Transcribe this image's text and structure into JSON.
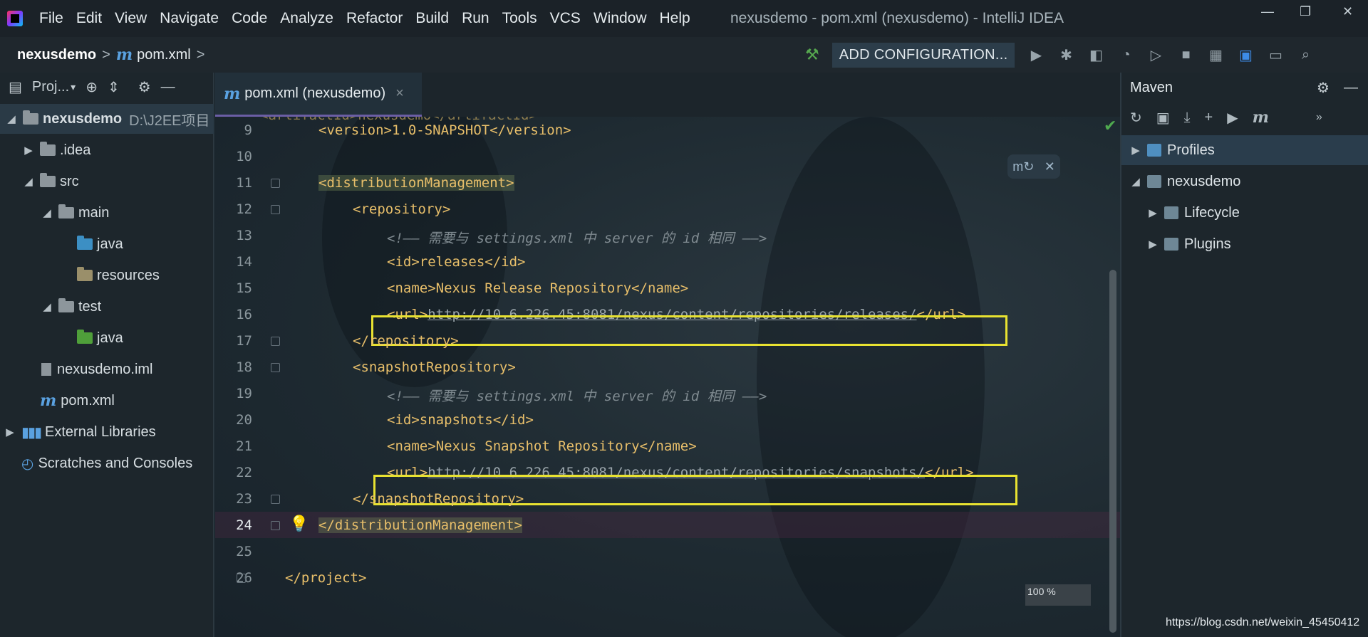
{
  "app": {
    "window_title": "nexusdemo - pom.xml (nexusdemo) - IntelliJ IDEA"
  },
  "menu": [
    "File",
    "Edit",
    "View",
    "Navigate",
    "Code",
    "Analyze",
    "Refactor",
    "Build",
    "Run",
    "Tools",
    "VCS",
    "Window",
    "Help"
  ],
  "window_controls": {
    "minimize": "—",
    "restore": "❐",
    "close": "✕"
  },
  "navbar": {
    "project": "nexusdemo",
    "file": "pom.xml",
    "separator": ">",
    "m_glyph": "m",
    "add_config": "ADD CONFIGURATION..."
  },
  "project_pane": {
    "title": "Proj...",
    "items": [
      {
        "label": "nexusdemo",
        "hint": "D:\\J2EE项目",
        "selected": true
      },
      {
        "label": ".idea"
      },
      {
        "label": "src"
      },
      {
        "label": "main"
      },
      {
        "label": "java"
      },
      {
        "label": "resources"
      },
      {
        "label": "test"
      },
      {
        "label": "java"
      },
      {
        "label": "nexusdemo.iml"
      },
      {
        "label": "pom.xml"
      },
      {
        "label": "External Libraries"
      },
      {
        "label": "Scratches and Consoles"
      }
    ]
  },
  "editor": {
    "tab_label": "pom.xml (nexusdemo)",
    "tab_close": "×",
    "zoom": "100 %",
    "lines": [
      {
        "n": "9",
        "text": "<version>1.0-SNAPSHOT</version>"
      },
      {
        "n": "10",
        "text": ""
      },
      {
        "n": "11",
        "text": "<distributionManagement>"
      },
      {
        "n": "12",
        "text": "<repository>"
      },
      {
        "n": "13",
        "text": "<!—— 需要与 settings.xml 中 server 的 id 相同 ——>"
      },
      {
        "n": "14",
        "text": "<id>releases</id>"
      },
      {
        "n": "15",
        "text": "<name>Nexus Release Repository</name>"
      },
      {
        "n": "16",
        "open": "<url>",
        "url": "http://10.6.226.45:8081/nexus/content/repositories/releases/",
        "close": "</url>"
      },
      {
        "n": "17",
        "text": "</repository>"
      },
      {
        "n": "18",
        "text": "<snapshotRepository>"
      },
      {
        "n": "19",
        "text": "<!—— 需要与 settings.xml 中 server 的 id 相同 ——>"
      },
      {
        "n": "20",
        "text": "<id>snapshots</id>"
      },
      {
        "n": "21",
        "text": "<name>Nexus Snapshot Repository</name>"
      },
      {
        "n": "22",
        "open": "<url>",
        "url": "http://10.6.226.45:8081/nexus/content/repositories/snapshots/",
        "close": "</url>"
      },
      {
        "n": "23",
        "text": "</snapshotRepository>"
      },
      {
        "n": "24",
        "text": "</distributionManagement>"
      },
      {
        "n": "25",
        "text": ""
      },
      {
        "n": "26",
        "text": "</project>"
      }
    ]
  },
  "maven_pane": {
    "title": "Maven",
    "items": [
      {
        "label": "Profiles",
        "selected": true
      },
      {
        "label": "nexusdemo"
      },
      {
        "label": "Lifecycle"
      },
      {
        "label": "Plugins"
      }
    ]
  },
  "watermark": "https://blog.csdn.net/weixin_45450412",
  "colors": {
    "highlight_box": "#e8e231",
    "tag": "#e8bf6a",
    "selection": "#2a3a46"
  }
}
